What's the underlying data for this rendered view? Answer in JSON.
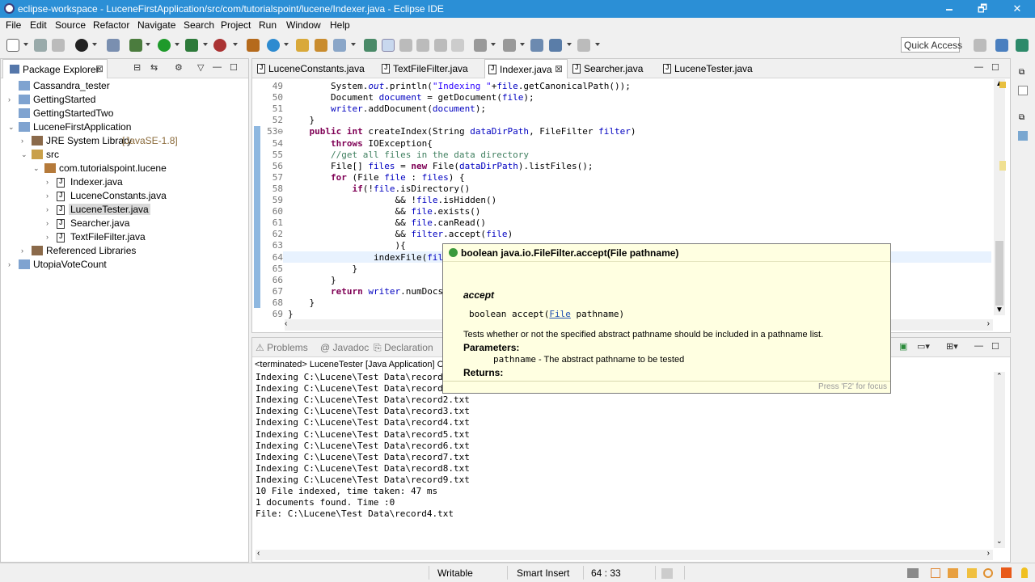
{
  "window": {
    "title": "eclipse-workspace - LuceneFirstApplication/src/com/tutorialspoint/lucene/Indexer.java - Eclipse IDE",
    "minimize": "🗕",
    "maximize": "🗗",
    "close": "✕"
  },
  "menu": [
    "File",
    "Edit",
    "Source",
    "Refactor",
    "Navigate",
    "Search",
    "Project",
    "Run",
    "Window",
    "Help"
  ],
  "toolbar": {
    "quick_access": "Quick Access"
  },
  "package_explorer": {
    "tab": "Package Explorer",
    "tree": [
      {
        "label": "Cassandra_tester",
        "arrow": ""
      },
      {
        "label": "GettingStarted",
        "arrow": "›"
      },
      {
        "label": "GettingStartedTwo",
        "arrow": ""
      },
      {
        "label": "LuceneFirstApplication",
        "arrow": "⌄"
      },
      {
        "label": "JRE System Library",
        "suffix": "[JavaSE-1.8]",
        "arrow": "›"
      },
      {
        "label": "src",
        "arrow": "⌄"
      },
      {
        "label": "com.tutorialspoint.lucene",
        "arrow": "⌄"
      },
      {
        "label": "Indexer.java",
        "arrow": "›"
      },
      {
        "label": "LuceneConstants.java",
        "arrow": "›"
      },
      {
        "label": "LuceneTester.java",
        "arrow": "›",
        "selected": true
      },
      {
        "label": "Searcher.java",
        "arrow": "›"
      },
      {
        "label": "TextFileFilter.java",
        "arrow": "›"
      },
      {
        "label": "Referenced Libraries",
        "arrow": "›"
      },
      {
        "label": "UtopiaVoteCount",
        "arrow": "›"
      }
    ]
  },
  "editor": {
    "tabs": [
      "LuceneConstants.java",
      "TextFileFilter.java",
      "Indexer.java",
      "Searcher.java",
      "LuceneTester.java"
    ],
    "active_tab": "Indexer.java",
    "line_numbers": [
      "49",
      "50",
      "51",
      "52",
      "53⊖",
      "54",
      "55",
      "56",
      "57",
      "58",
      "59",
      "60",
      "61",
      "62",
      "63",
      "64",
      "65",
      "66",
      "67",
      "68",
      "69"
    ],
    "lines": [
      "        System.out.println(\"Indexing \"+file.getCanonicalPath());",
      "        Document document = getDocument(file);",
      "        writer.addDocument(document);",
      "    }",
      "    public int createIndex(String dataDirPath, FileFilter filter)",
      "        throws IOException{",
      "        //get all files in the data directory",
      "        File[] files = new File(dataDirPath).listFiles();",
      "        for (File file : files) {",
      "            if(!file.isDirectory()",
      "                    && !file.isHidden()",
      "                    && file.exists()",
      "                    && file.canRead()",
      "                    && filter.accept(file)",
      "                    ){",
      "                indexFile(file",
      "            }",
      "        }",
      "        return writer.numDocs(",
      "    }",
      "}"
    ]
  },
  "tooltip": {
    "header": "boolean java.io.FileFilter.accept(File pathname)",
    "name": "accept",
    "sig_pre": "boolean accept(",
    "sig_link": "File",
    "sig_post": " pathname)",
    "description": "Tests whether or not the specified abstract pathname should be included in a pathname list.",
    "params_label": "Parameters:",
    "param_name": "pathname",
    "param_desc": " - The abstract pathname to be tested",
    "returns_label": "Returns:",
    "footer": "Press 'F2' for focus"
  },
  "bottom_tabs": [
    "Problems",
    "Javadoc",
    "Declaration"
  ],
  "console": {
    "header": "<terminated> LuceneTester [Java Application] C",
    "lines": [
      "Indexing C:\\Lucene\\Test Data\\record",
      "Indexing C:\\Lucene\\Test Data\\record",
      "Indexing C:\\Lucene\\Test Data\\record2.txt",
      "Indexing C:\\Lucene\\Test Data\\record3.txt",
      "Indexing C:\\Lucene\\Test Data\\record4.txt",
      "Indexing C:\\Lucene\\Test Data\\record5.txt",
      "Indexing C:\\Lucene\\Test Data\\record6.txt",
      "Indexing C:\\Lucene\\Test Data\\record7.txt",
      "Indexing C:\\Lucene\\Test Data\\record8.txt",
      "Indexing C:\\Lucene\\Test Data\\record9.txt",
      "10 File indexed, time taken: 47 ms",
      "1 documents found. Time :0",
      "File: C:\\Lucene\\Test Data\\record4.txt"
    ]
  },
  "status": {
    "mode": "Writable",
    "insert": "Smart Insert",
    "position": "64 : 33"
  },
  "colors": {
    "titlebar": "#2b8fd6",
    "keyword": "#7f0055",
    "field": "#0000c0",
    "string": "#2a00ff",
    "comment": "#3f7f5f",
    "tooltip_bg": "#ffffe1"
  }
}
